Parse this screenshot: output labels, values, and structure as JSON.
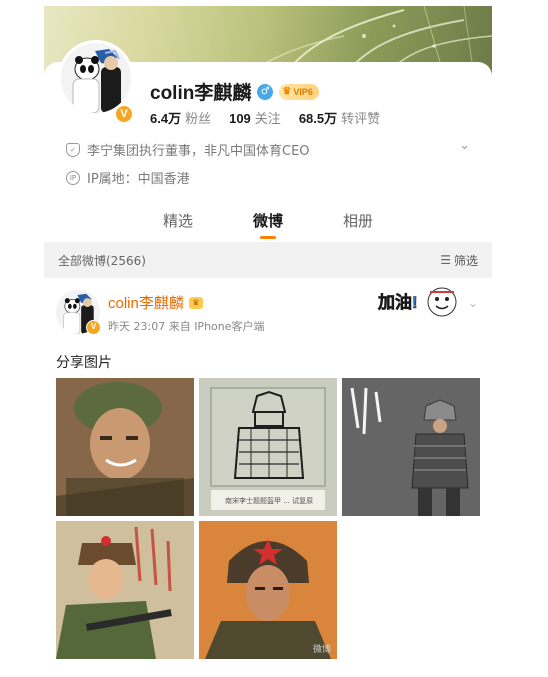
{
  "profile": {
    "username": "colin李麒麟",
    "vip_level": "VIP6",
    "verified_badge": "V",
    "gender_icon": "♂",
    "stats": [
      {
        "value": "6.4万",
        "label": "粉丝"
      },
      {
        "value": "109",
        "label": "关注"
      },
      {
        "value": "68.5万",
        "label": "转评赞"
      }
    ],
    "bio": "李宁集团执行董事，非凡中国体育CEO",
    "ip_location": "IP属地：中国香港",
    "accent": "#ff8200"
  },
  "tabs": [
    {
      "label": "精选",
      "active": false
    },
    {
      "label": "微博",
      "active": true
    },
    {
      "label": "相册",
      "active": false
    }
  ],
  "filterbar": {
    "title": "全部微博(2566)",
    "filter_label": "筛选"
  },
  "post": {
    "author": "colin李麒麟",
    "meta": "昨天 23:07  来自 IPhone客户端",
    "text": "分享图片",
    "sticker_text": "加油!",
    "images": [
      {
        "caption": "",
        "icon": "soldier-portrait"
      },
      {
        "caption": "南宋李士题题盔甲 ... 试复原",
        "icon": "armor-stele-rubbing"
      },
      {
        "caption": "",
        "icon": "armor-figure"
      },
      {
        "caption": "",
        "icon": "soldier-with-gun"
      },
      {
        "caption": "",
        "icon": "soldier-portrait-red-star"
      }
    ]
  },
  "watermark": "微博"
}
